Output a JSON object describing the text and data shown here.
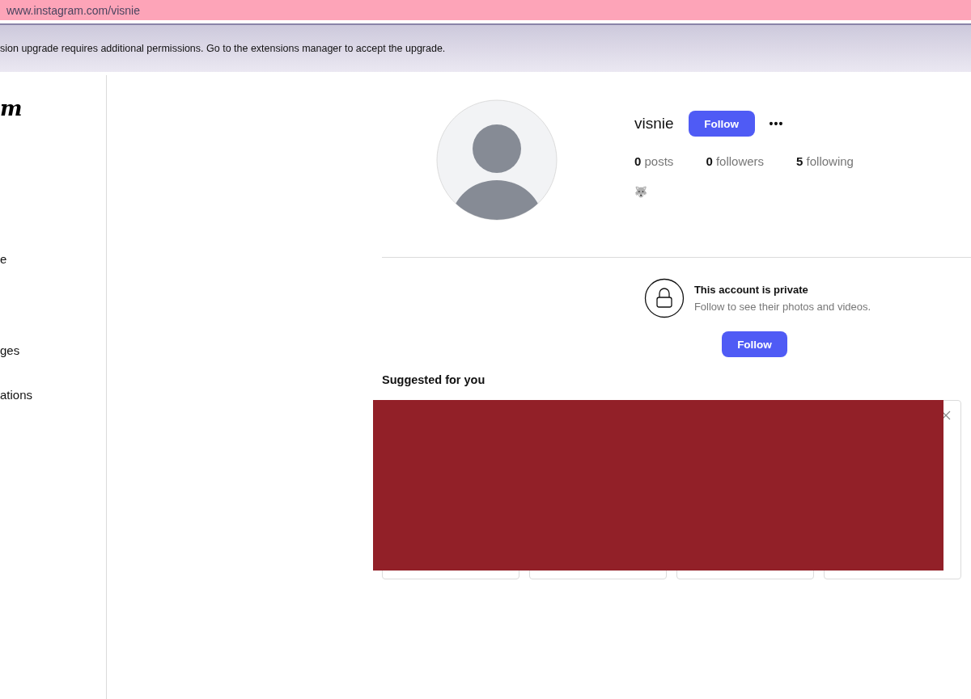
{
  "address_bar": {
    "url": "www.instagram.com/visnie"
  },
  "notification": {
    "message": "sion upgrade requires additional permissions. Go to the extensions manager to accept the upgrade."
  },
  "sidebar": {
    "logo": "m",
    "items": [
      {
        "label": "e"
      },
      {
        "label": "ges"
      },
      {
        "label": "ations"
      }
    ]
  },
  "profile": {
    "username": "visnie",
    "follow_button": "Follow",
    "more": "•••",
    "stats": [
      {
        "count": "0",
        "label": "posts"
      },
      {
        "count": "0",
        "label": "followers"
      },
      {
        "count": "5",
        "label": "following"
      }
    ],
    "bio": "🐺"
  },
  "private_notice": {
    "title": "This account is private",
    "subtitle": "Follow to see their photos and videos.",
    "follow_button": "Follow"
  },
  "suggested": {
    "heading": "Suggested for you",
    "redacted": true
  }
}
